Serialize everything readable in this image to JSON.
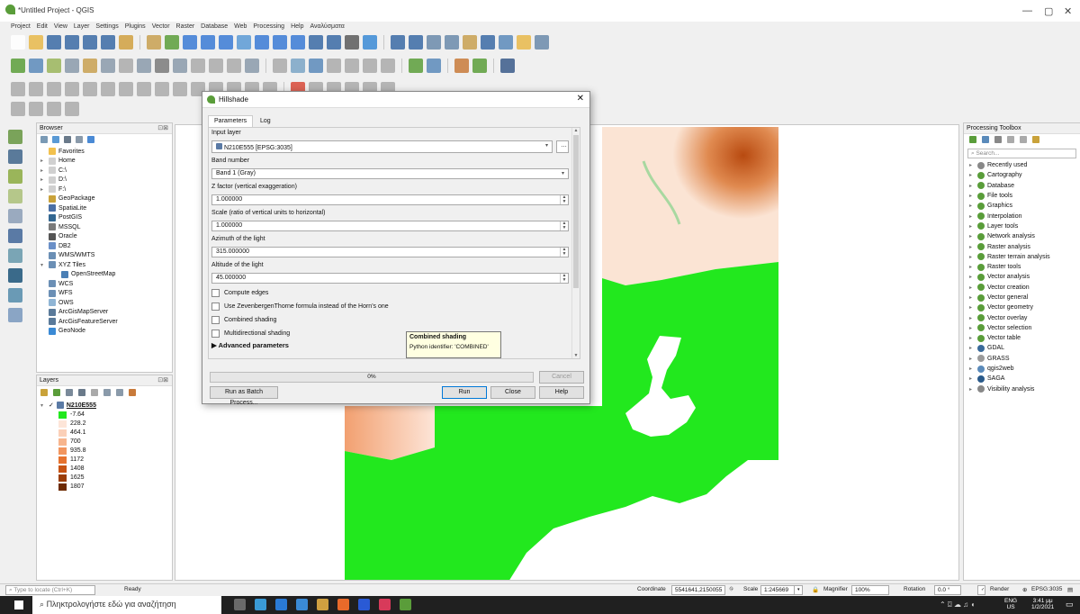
{
  "window": {
    "title": "*Untitled Project - QGIS"
  },
  "menu": [
    "Project",
    "Edit",
    "View",
    "Layer",
    "Settings",
    "Plugins",
    "Vector",
    "Raster",
    "Database",
    "Web",
    "Processing",
    "Help",
    "Αναλύσματα"
  ],
  "browser": {
    "title": "Browser",
    "items": [
      {
        "label": "Favorites",
        "arrow": "",
        "color": "#f2c14e"
      },
      {
        "label": "Home",
        "arrow": "▸",
        "color": "#d0d0d0"
      },
      {
        "label": "C:\\",
        "arrow": "▸",
        "color": "#d0d0d0"
      },
      {
        "label": "D:\\",
        "arrow": "▸",
        "color": "#d0d0d0"
      },
      {
        "label": "F:\\",
        "arrow": "▸",
        "color": "#d0d0d0"
      },
      {
        "label": "GeoPackage",
        "arrow": "",
        "color": "#c9a23a"
      },
      {
        "label": "SpatiaLite",
        "arrow": "",
        "color": "#4a6fa5"
      },
      {
        "label": "PostGIS",
        "arrow": "",
        "color": "#336791"
      },
      {
        "label": "MSSQL",
        "arrow": "",
        "color": "#7a7a7a"
      },
      {
        "label": "Oracle",
        "arrow": "",
        "color": "#555"
      },
      {
        "label": "DB2",
        "arrow": "",
        "color": "#6a8fc7"
      },
      {
        "label": "WMS/WMTS",
        "arrow": "",
        "color": "#6b8fb5"
      },
      {
        "label": "XYZ Tiles",
        "arrow": "▾",
        "color": "#6b8fb5"
      },
      {
        "label": "OpenStreetMap",
        "arrow": "",
        "color": "#4a7fb5",
        "indent": true
      },
      {
        "label": "WCS",
        "arrow": "",
        "color": "#6b8fb5"
      },
      {
        "label": "WFS",
        "arrow": "",
        "color": "#6b8fb5"
      },
      {
        "label": "OWS",
        "arrow": "",
        "color": "#8fb5d5"
      },
      {
        "label": "ArcGisMapServer",
        "arrow": "",
        "color": "#5a7a9a"
      },
      {
        "label": "ArcGisFeatureServer",
        "arrow": "",
        "color": "#5a7a9a"
      },
      {
        "label": "GeoNode",
        "arrow": "",
        "color": "#3a8ad5"
      }
    ]
  },
  "layers": {
    "title": "Layers",
    "layer_name": "N210E555",
    "legend": [
      {
        "label": "-7.64",
        "color": "#22e81e"
      },
      {
        "label": "228.2",
        "color": "#fde5d8"
      },
      {
        "label": "464.1",
        "color": "#fbd0b8"
      },
      {
        "label": "700",
        "color": "#f7b58d"
      },
      {
        "label": "935.8",
        "color": "#f2955e"
      },
      {
        "label": "1172",
        "color": "#e6722e"
      },
      {
        "label": "1408",
        "color": "#c75312"
      },
      {
        "label": "1625",
        "color": "#9b3d07"
      },
      {
        "label": "1807",
        "color": "#6d2a02"
      }
    ]
  },
  "dialog": {
    "title": "Hillshade",
    "tabs": [
      "Parameters",
      "Log"
    ],
    "input_layer_label": "Input layer",
    "input_layer_value": "N210E555 [EPSG:3035]",
    "band_label": "Band number",
    "band_value": "Band 1 (Gray)",
    "z_label": "Z factor (vertical exaggeration)",
    "z_value": "1.000000",
    "scale_label": "Scale (ratio of vertical units to horizontal)",
    "scale_value": "1.000000",
    "azimuth_label": "Azimuth of the light",
    "azimuth_value": "315.000000",
    "altitude_label": "Altitude of the light",
    "altitude_value": "45.000000",
    "checkboxes": [
      "Compute edges",
      "Use ZevenbergenThorne formula instead of the Horn's one",
      "Combined shading",
      "Multidirectional shading"
    ],
    "advanced": "Advanced parameters",
    "progress_text": "0%",
    "progress": 0,
    "cancel": "Cancel",
    "batch": "Run as Batch Process...",
    "run": "Run",
    "close": "Close",
    "help": "Help",
    "tooltip_title": "Combined shading",
    "tooltip_body": "Python identifier: 'COMBINED'"
  },
  "toolbox": {
    "title": "Processing Toolbox",
    "search_placeholder": "Search...",
    "items": [
      {
        "label": "Recently used",
        "color": "#888"
      },
      {
        "label": "Cartography",
        "color": "#5a9d3a"
      },
      {
        "label": "Database",
        "color": "#5a9d3a"
      },
      {
        "label": "File tools",
        "color": "#5a9d3a"
      },
      {
        "label": "Graphics",
        "color": "#5a9d3a"
      },
      {
        "label": "Interpolation",
        "color": "#5a9d3a"
      },
      {
        "label": "Layer tools",
        "color": "#5a9d3a"
      },
      {
        "label": "Network analysis",
        "color": "#5a9d3a"
      },
      {
        "label": "Raster analysis",
        "color": "#5a9d3a"
      },
      {
        "label": "Raster terrain analysis",
        "color": "#5a9d3a"
      },
      {
        "label": "Raster tools",
        "color": "#5a9d3a"
      },
      {
        "label": "Vector analysis",
        "color": "#5a9d3a"
      },
      {
        "label": "Vector creation",
        "color": "#5a9d3a"
      },
      {
        "label": "Vector general",
        "color": "#5a9d3a"
      },
      {
        "label": "Vector geometry",
        "color": "#5a9d3a"
      },
      {
        "label": "Vector overlay",
        "color": "#5a9d3a"
      },
      {
        "label": "Vector selection",
        "color": "#5a9d3a"
      },
      {
        "label": "Vector table",
        "color": "#5a9d3a"
      },
      {
        "label": "GDAL",
        "color": "#3a6a9a"
      },
      {
        "label": "GRASS",
        "color": "#9a9a9a"
      },
      {
        "label": "qgis2web",
        "color": "#5a8aba"
      },
      {
        "label": "SAGA",
        "color": "#2a5a8a"
      },
      {
        "label": "Visibility analysis",
        "color": "#888"
      }
    ]
  },
  "statusbar": {
    "locate_placeholder": "Type to locate (Ctrl+K)",
    "ready": "Ready",
    "coordinate_label": "Coordinate",
    "coordinate": "5541641,2150055",
    "scale_label": "Scale",
    "scale": "1:245669",
    "magnifier_label": "Magnifier",
    "magnifier": "100%",
    "rotation_label": "Rotation",
    "rotation": "0.0 °",
    "render": "Render",
    "epsg": "EPSG:3035"
  },
  "taskbar": {
    "search": "Πληκτρολογήστε εδώ για αναζήτηση",
    "lang": "ENG",
    "lang2": "US",
    "time": "3:41 μμ",
    "date": "1/2/2021"
  },
  "colors": {
    "green": "#22e81e",
    "brown": "#d9783a",
    "dialog_bg": "#f0f0f0"
  }
}
